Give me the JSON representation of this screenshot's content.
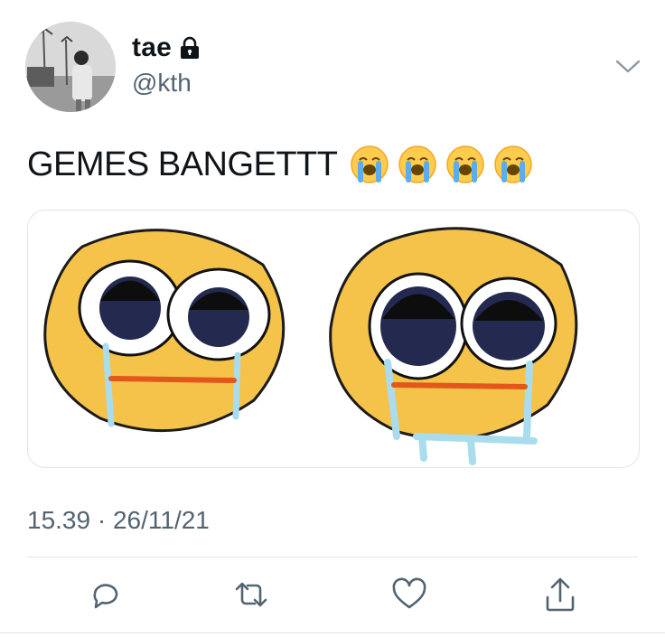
{
  "user": {
    "display_name": "tae",
    "handle": "@kth",
    "avatar_icon": "profile-photo",
    "protected_icon": "lock-icon"
  },
  "tweet": {
    "text": "GEMES BANGETTT",
    "emojis": [
      "loudly-crying-face",
      "loudly-crying-face",
      "loudly-crying-face",
      "loudly-crying-face"
    ],
    "media_description_icon": "crying-emoji-drawings"
  },
  "meta": {
    "timestamp": "15.39 · 26/11/21"
  },
  "actions": {
    "reply_icon": "reply-icon",
    "retweet_icon": "retweet-icon",
    "like_icon": "heart-icon",
    "share_icon": "share-icon"
  },
  "colors": {
    "text": "#0f1419",
    "secondary": "#536471",
    "border": "#e1e4e8",
    "emoji_yellow": "#f5c24a",
    "tear_blue": "#a9dcec"
  }
}
